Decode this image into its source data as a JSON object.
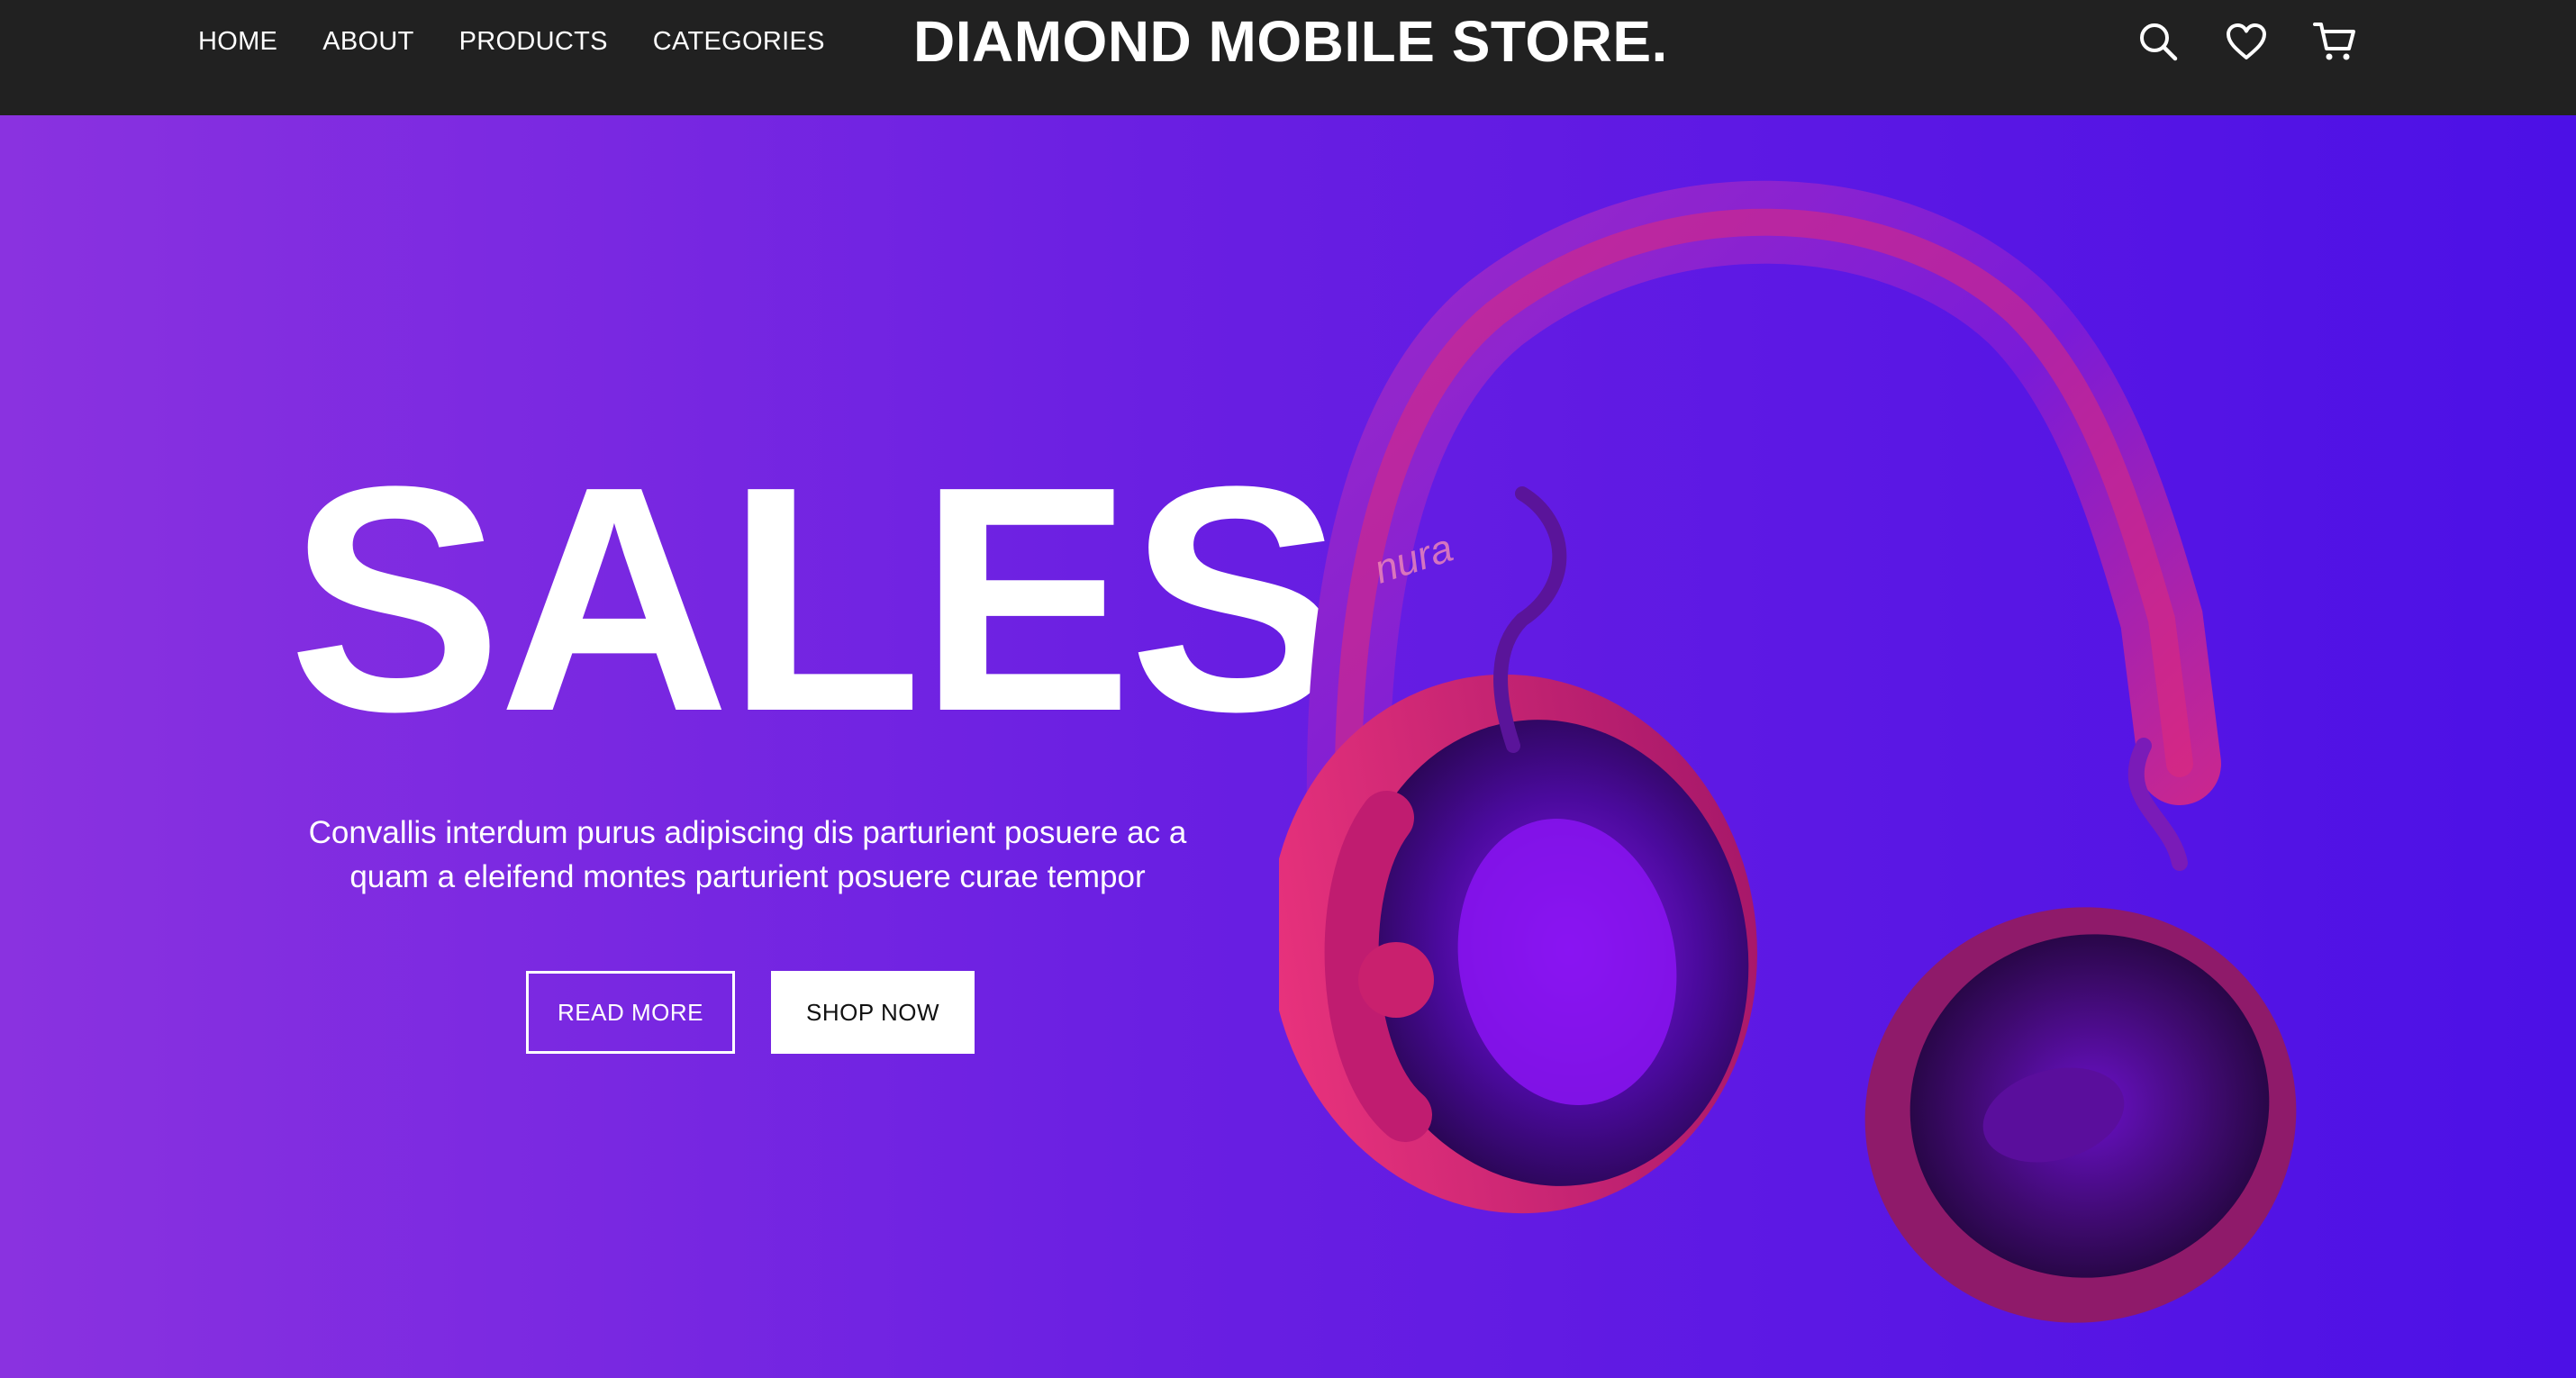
{
  "header": {
    "nav": [
      {
        "label": "HOME"
      },
      {
        "label": "ABOUT"
      },
      {
        "label": "PRODUCTS"
      },
      {
        "label": "CATEGORIES"
      }
    ],
    "brand": "DIAMOND MOBILE STORE.",
    "icons": [
      "search-icon",
      "heart-icon",
      "cart-icon"
    ]
  },
  "hero": {
    "title": "SALES",
    "description": "Convallis interdum purus adipiscing dis parturient posuere ac a quam a eleifend montes parturient posuere curae tempor",
    "buttons": {
      "read_more": "READ MORE",
      "shop_now": "SHOP NOW"
    },
    "product_brand": "nura"
  },
  "colors": {
    "topbar": "#212121",
    "hero_start": "#8a32e0",
    "hero_end": "#4c10e6",
    "headphone_pink": "#e02a7a",
    "headphone_purple": "#6a14d8",
    "text": "#ffffff"
  }
}
